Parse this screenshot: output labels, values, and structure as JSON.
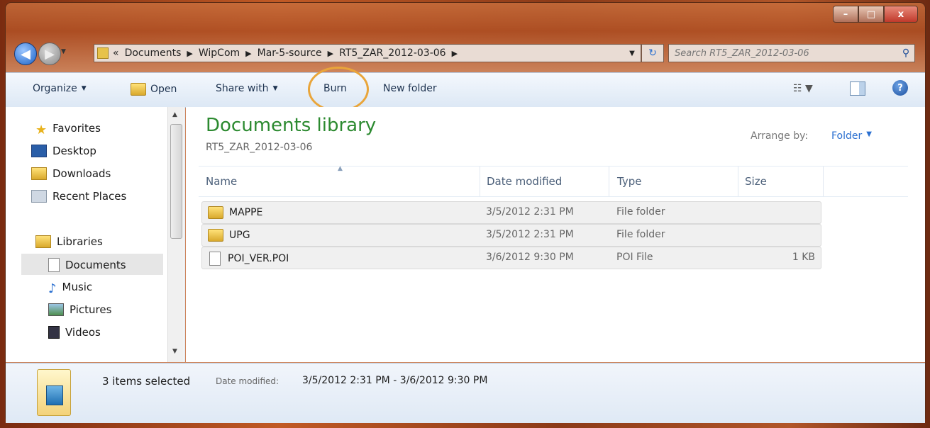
{
  "window": {
    "minimize": "–",
    "maximize": "□",
    "close": "x"
  },
  "nav": {
    "back_glyph": "◀",
    "forward_glyph": "▶",
    "breadcrumbs": [
      "«",
      "Documents",
      "WipCom",
      "Mar-5-source",
      "RT5_ZAR_2012-03-06"
    ],
    "search_placeholder": "Search RT5_ZAR_2012-03-06"
  },
  "toolbar": {
    "organize": "Organize",
    "open": "Open",
    "share_with": "Share with",
    "burn": "Burn",
    "new_folder": "New folder"
  },
  "navpane": {
    "favorites_header": "Favorites",
    "favorites": [
      "Desktop",
      "Downloads",
      "Recent Places"
    ],
    "libraries_header": "Libraries",
    "libraries": [
      "Documents",
      "Music",
      "Pictures",
      "Videos"
    ]
  },
  "main": {
    "title": "Documents library",
    "subtitle": "RT5_ZAR_2012-03-06",
    "arrange_label": "Arrange by:",
    "arrange_value": "Folder",
    "columns": [
      "Name",
      "Date modified",
      "Type",
      "Size"
    ],
    "rows": [
      {
        "name": "MAPPE",
        "date": "3/5/2012 2:31 PM",
        "type": "File folder",
        "size": "",
        "icon": "folder-icon"
      },
      {
        "name": "UPG",
        "date": "3/5/2012 2:31 PM",
        "type": "File folder",
        "size": "",
        "icon": "folder-icon"
      },
      {
        "name": "POI_VER.POI",
        "date": "3/6/2012 9:30 PM",
        "type": "POI File",
        "size": "1 KB",
        "icon": "file-icon"
      }
    ]
  },
  "status": {
    "count": "3 items selected",
    "date_label": "Date modified:",
    "date_value": "3/5/2012 2:31 PM - 3/6/2012 9:30 PM"
  },
  "colors": {
    "title_green": "#2c8a30",
    "link_blue": "#2a6fd0",
    "highlight_ring": "#e9a53a"
  }
}
